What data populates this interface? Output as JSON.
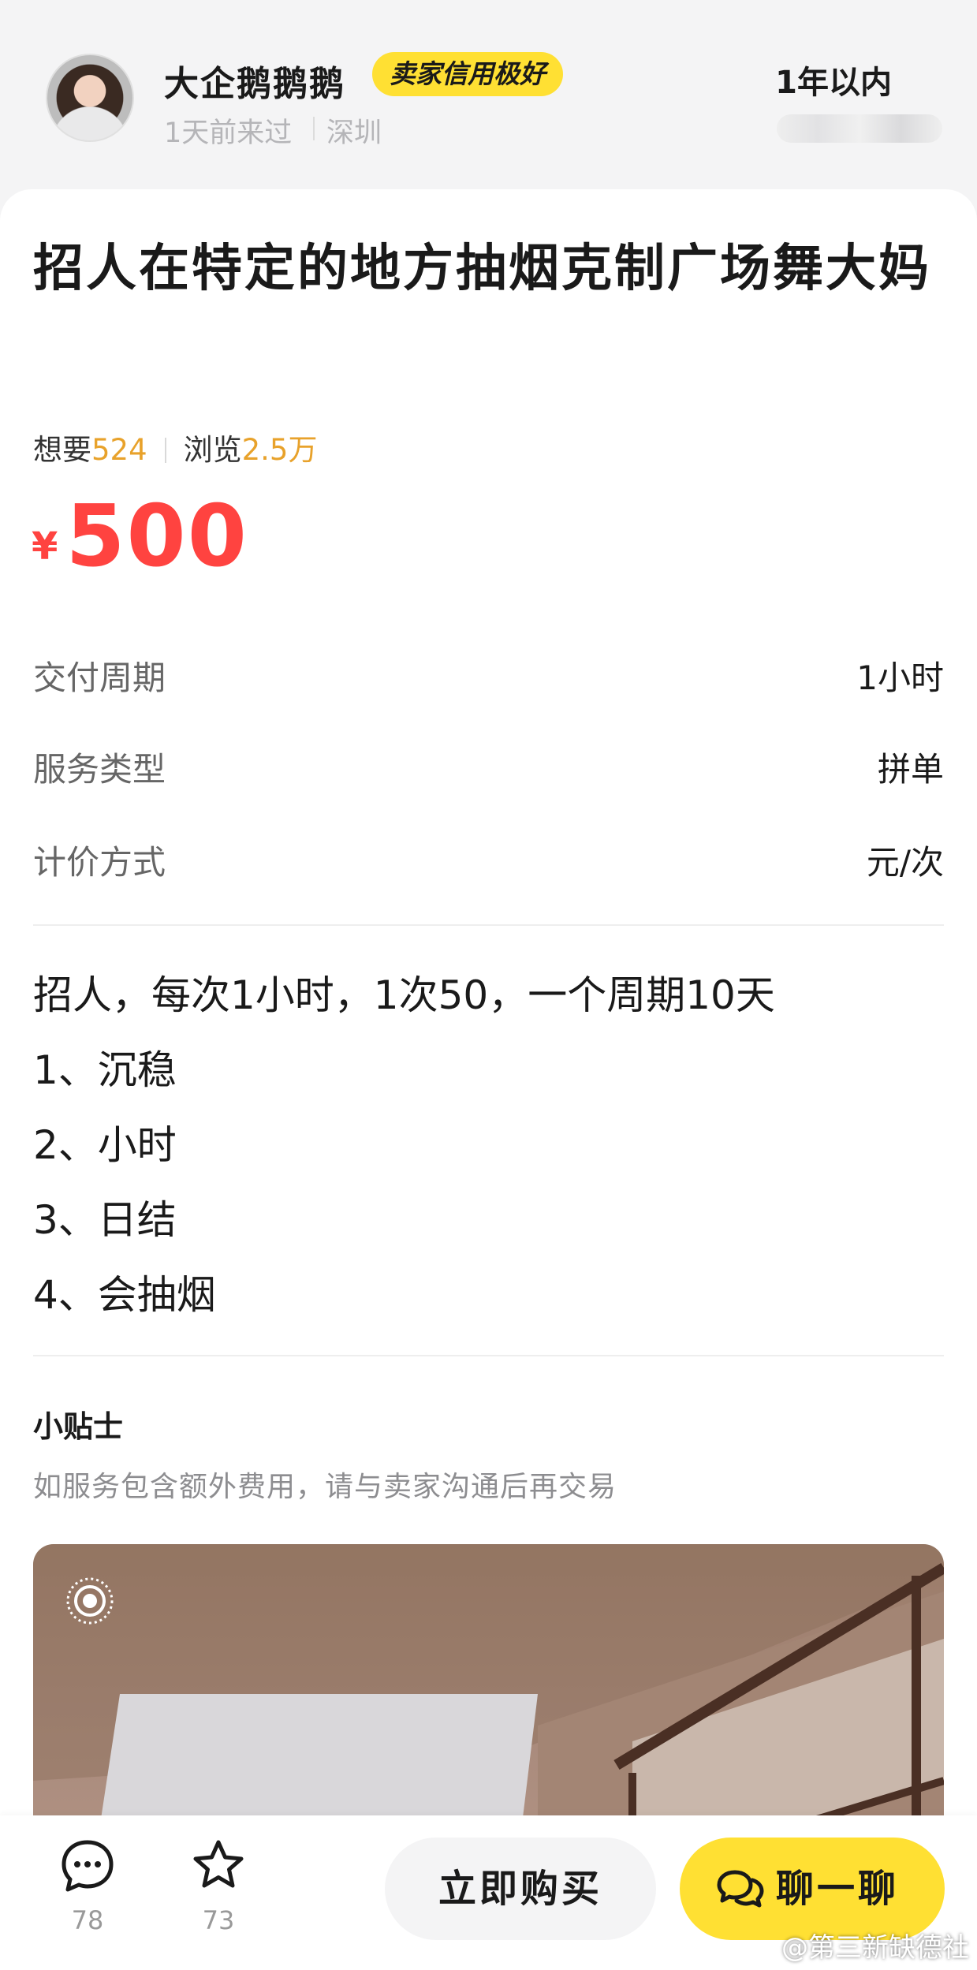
{
  "seller": {
    "name": "大企鹅鹅鹅",
    "credit_badge": "卖家信用极好",
    "last_seen": "1天前来过",
    "location": "深圳",
    "duration": "1年以内"
  },
  "listing": {
    "title": "招人在特定的地方抽烟克制广场舞大妈",
    "want_label": "想要",
    "want_count": "524",
    "view_label": "浏览",
    "view_count": "2.5万",
    "currency_symbol": "¥",
    "price": "500"
  },
  "attributes": [
    {
      "label": "交付周期",
      "value": "1小时"
    },
    {
      "label": "服务类型",
      "value": "拼单"
    },
    {
      "label": "计价方式",
      "value": "元/次"
    }
  ],
  "description": [
    "招人，每次1小时，1次50，一个周期10天",
    "1、沉稳",
    "2、小时",
    "3、日结",
    "4、会抽烟"
  ],
  "tips": {
    "title": "小贴士",
    "text": "如服务包含额外费用，请与卖家沟通后再交易"
  },
  "bottom_bar": {
    "comment_count": "78",
    "favorite_count": "73",
    "buy_label": "立即购买",
    "chat_label": "聊一聊"
  },
  "watermark": "@第三新缺德社",
  "colors": {
    "accent_yellow": "#ffe033",
    "price_red": "#ff4340",
    "stat_orange": "#e8a22b"
  }
}
